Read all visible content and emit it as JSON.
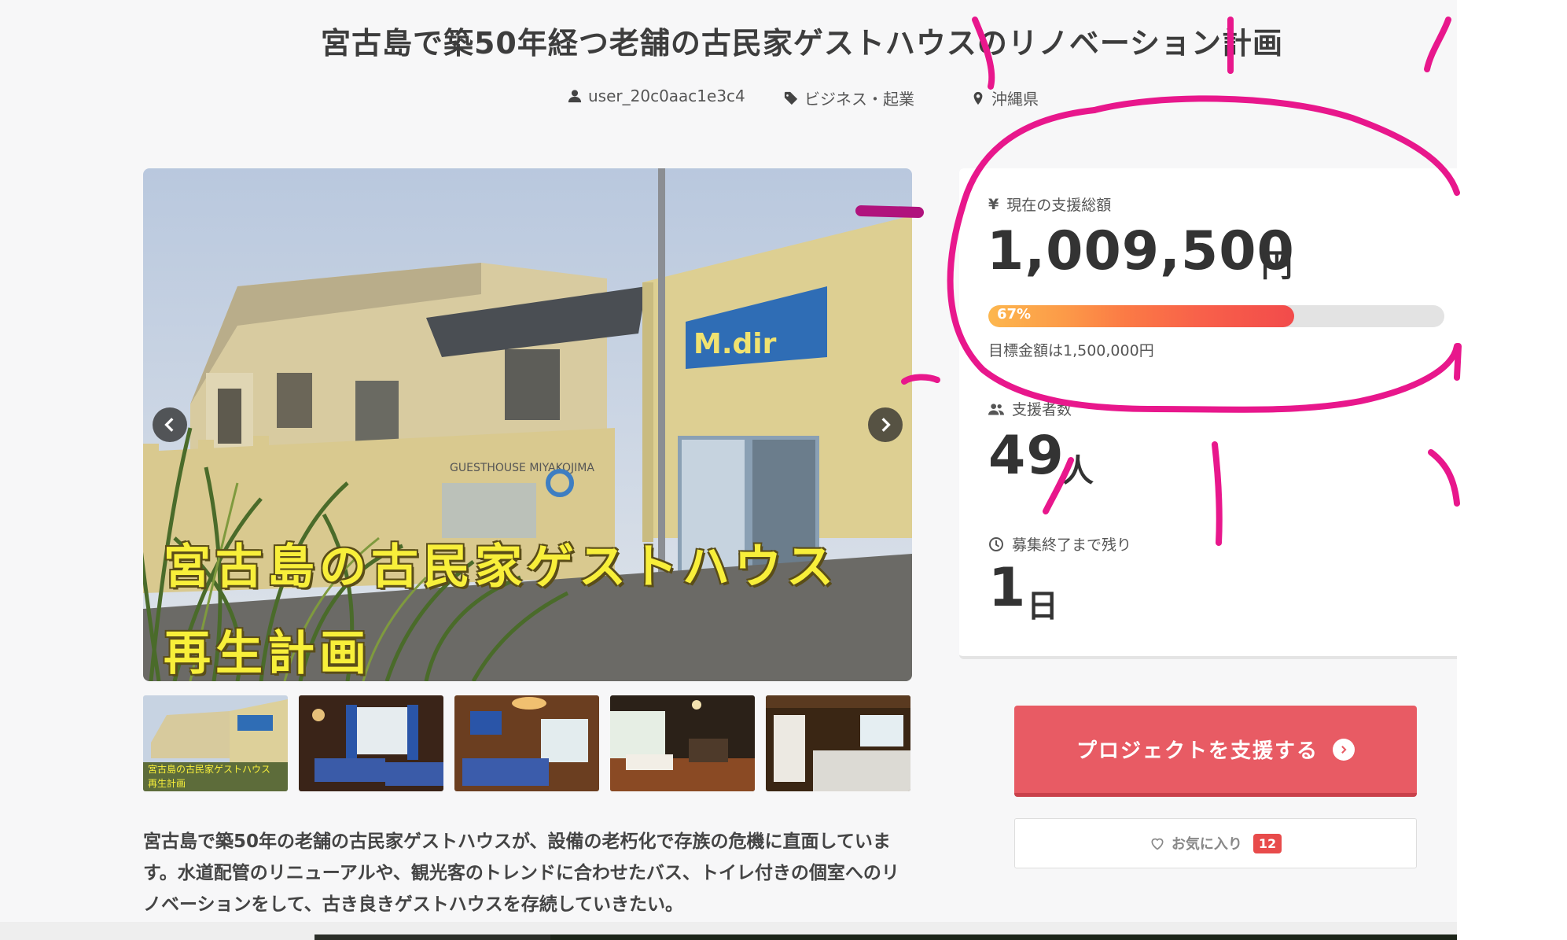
{
  "project": {
    "title": "宮古島で築50年経つ老舗の古民家ゲストハウスのリノベーション計画",
    "author": "user_20c0aac1e3c4",
    "category": "ビジネス・起業",
    "location": "沖縄県",
    "image_caption_line1": "宮古島の古民家ゲストハウス",
    "image_caption_line2": "再生計画",
    "image_sign": "M.dir",
    "image_wall_text": "GUESTHOUSE MIYAKOJIMA",
    "thumb_caption_line1": "宮古島の古民家ゲストハウス",
    "thumb_caption_line2": "再生計画",
    "description": "宮古島で築50年の老舗の古民家ゲストハウスが、設備の老朽化で存族の危機に直面しています。水道配管のリニューアルや、観光客のトレンドに合わせたバス、トイレ付きの個室へのリノベーションをして、古き良きゲストハウスを存続していきたい。"
  },
  "stats": {
    "total_label": "現在の支援総額",
    "total_amount": "1,009,500",
    "total_unit": "円",
    "progress_percent": 67,
    "progress_label": "67%",
    "goal_text": "目標金額は1,500,000円",
    "backers_label": "支援者数",
    "backers_count": "49",
    "backers_unit": "人",
    "remaining_label": "募集終了まで残り",
    "remaining_count": "1",
    "remaining_unit": "日"
  },
  "actions": {
    "support_label": "プロジェクトを支援する",
    "favorite_label": "お気に入り",
    "favorite_count": "12"
  },
  "colors": {
    "accent": "#e85b64",
    "annotation": "#e8178c",
    "caption_yellow": "#f8ef3a"
  }
}
